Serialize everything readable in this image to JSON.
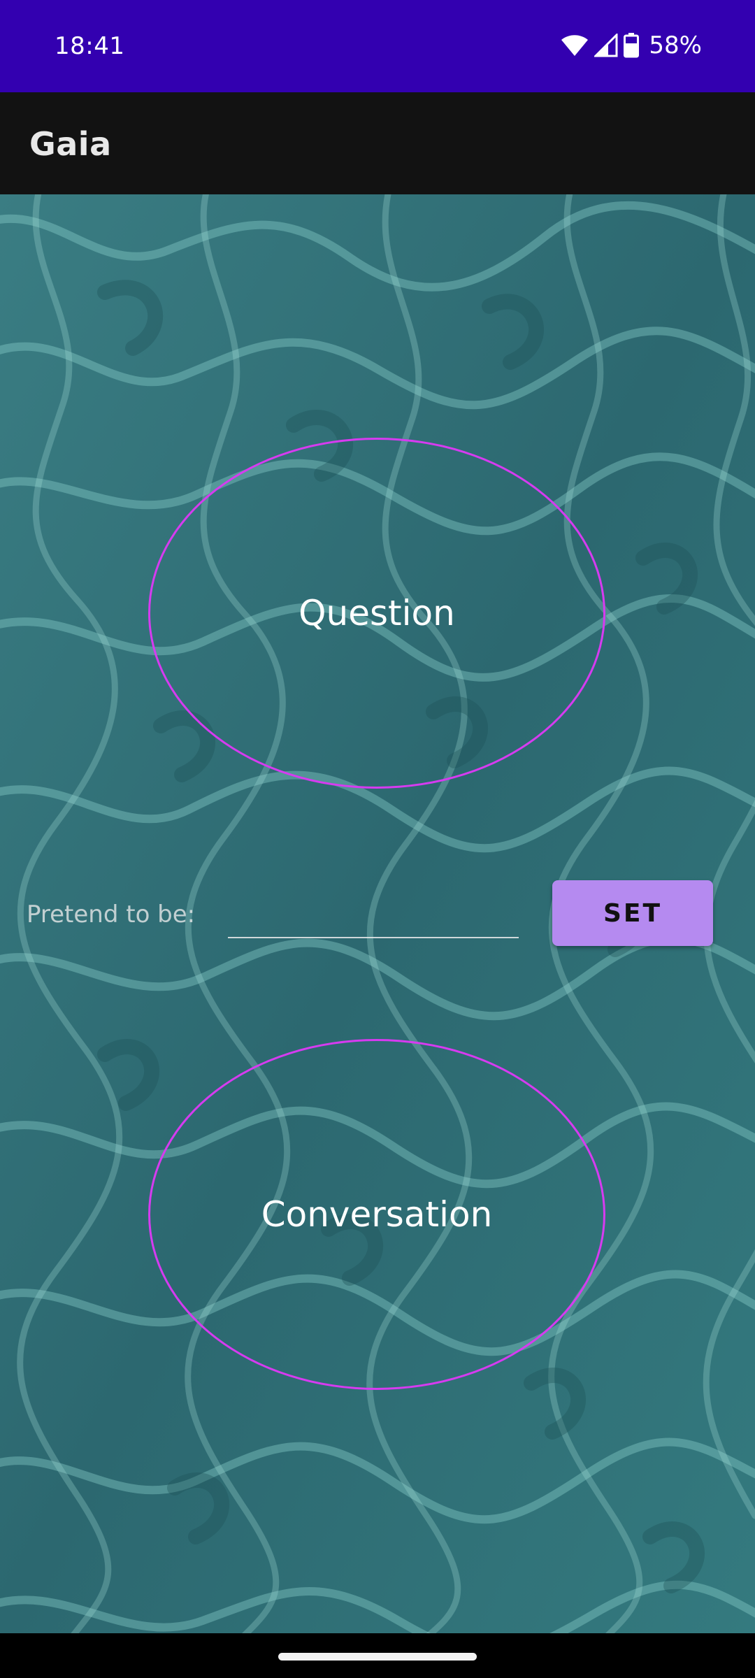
{
  "status_bar": {
    "time": "18:41",
    "battery_percent": "58%",
    "icons": [
      "wifi-icon",
      "cellular-signal-icon",
      "battery-icon"
    ],
    "background_color": "#3300b0"
  },
  "app_bar": {
    "title": "Gaia",
    "background_color": "#121212"
  },
  "main": {
    "question_button_label": "Question",
    "conversation_button_label": "Conversation",
    "pretend_label": "Pretend to be:",
    "pretend_input_value": "",
    "set_button_label": "SET",
    "accent_color": "#d63bf0",
    "set_button_color": "#b58af0",
    "background": "water-caustics-texture"
  },
  "nav_bar": {
    "home_handle": "home-gesture-handle"
  }
}
